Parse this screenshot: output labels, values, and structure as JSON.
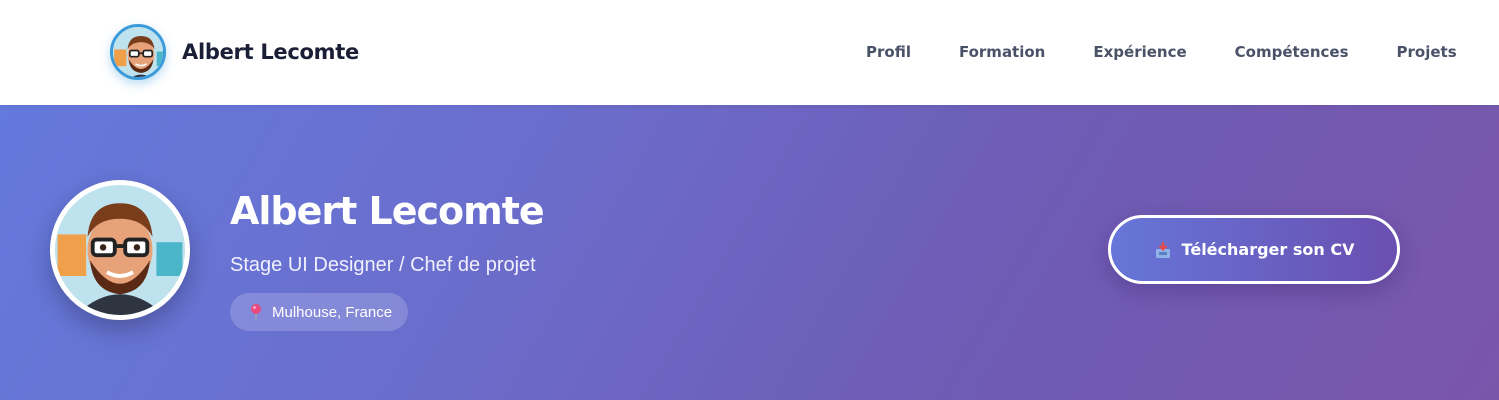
{
  "header": {
    "brand_name": "Albert Lecomte",
    "nav": [
      "Profil",
      "Formation",
      "Expérience",
      "Compétences",
      "Projets"
    ]
  },
  "hero": {
    "name": "Albert Lecomte",
    "role": "Stage UI Designer / Chef de projet",
    "location": "Mulhouse, France",
    "cv_button_label": "Télécharger son CV"
  },
  "icons": {
    "location": "pin-icon",
    "download": "download-icon"
  },
  "colors": {
    "accent": "#3b9ad9",
    "hero_start": "#6479dc",
    "hero_end": "#7a56ab",
    "brand_text": "#1a1f36"
  }
}
